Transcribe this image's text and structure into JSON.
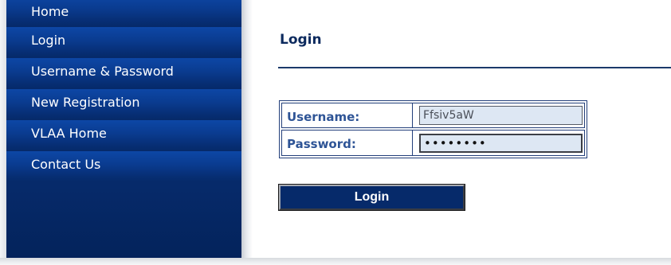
{
  "sidebar": {
    "items": [
      {
        "label": "Home"
      },
      {
        "label": "Login"
      },
      {
        "label": "Username & Password"
      },
      {
        "label": "New Registration"
      },
      {
        "label": "VLAA Home"
      },
      {
        "label": "Contact Us"
      }
    ]
  },
  "main": {
    "title": "Login",
    "form": {
      "username_label": "Username:",
      "username_value": "Ffsiv5aW",
      "password_label": "Password:",
      "password_value": "••••••••",
      "submit_label": "Login"
    }
  },
  "colors": {
    "sidebar_bg": "#062a6a",
    "nav_highlight": "#0d47a6",
    "title_text": "#0c2a5e",
    "label_text": "#2e5496",
    "input_bg": "#dde7f3"
  }
}
